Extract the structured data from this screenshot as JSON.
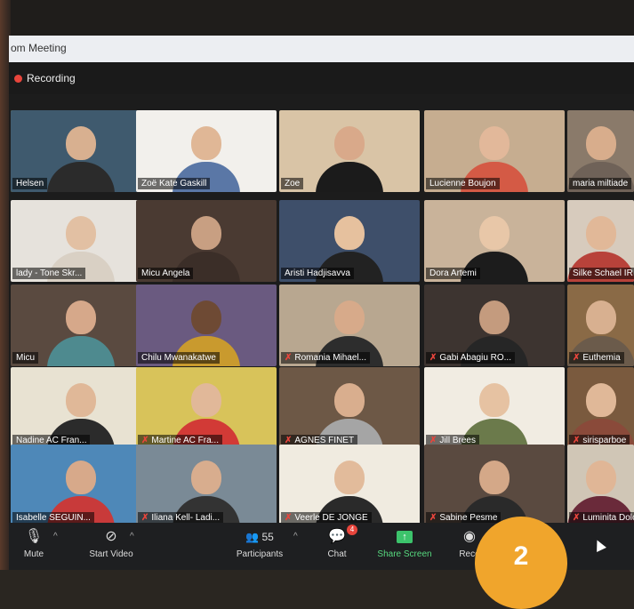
{
  "window": {
    "title": "om Meeting"
  },
  "recording": {
    "label": "Recording"
  },
  "participants": [
    {
      "name": "Helsen",
      "muted": false,
      "bg": "#3f5a6e",
      "skin": "#d8b090",
      "shirt": "#2b2b2b"
    },
    {
      "name": "Zoë Kate Gaskill",
      "muted": false,
      "bg": "#f2f0ec",
      "skin": "#e0b796",
      "shirt": "#5a77a6"
    },
    {
      "name": "Zoe",
      "muted": false,
      "bg": "#d9c4a6",
      "skin": "#d9a98a",
      "shirt": "#1b1b1b"
    },
    {
      "name": "Lucienne Boujon",
      "muted": false,
      "bg": "#c6ad90",
      "skin": "#e2b89a",
      "shirt": "#d45a45"
    },
    {
      "name": "maria miltiade",
      "muted": false,
      "bg": "#8a7a6a",
      "skin": "#d8ad8c",
      "shirt": "#6f6258"
    },
    {
      "name": "lady - Tone Skr...",
      "muted": false,
      "bg": "#e6e2dc",
      "skin": "#e2c0a3",
      "shirt": "#d9d0c4"
    },
    {
      "name": "Micu Angela",
      "muted": false,
      "bg": "#4a3a32",
      "skin": "#c89f82",
      "shirt": "#3b2e28"
    },
    {
      "name": "Aristi Hadjisavva",
      "muted": false,
      "bg": "#3e4f6a",
      "skin": "#e6c19e",
      "shirt": "#222"
    },
    {
      "name": "Dora Artemi",
      "muted": false,
      "bg": "#c9b39a",
      "skin": "#e8c7a8",
      "shirt": "#1c1c1c"
    },
    {
      "name": "Silke Schael IR",
      "muted": false,
      "bg": "#d7cbbd",
      "skin": "#e1b898",
      "shirt": "#b8423a"
    },
    {
      "name": "Micu",
      "muted": false,
      "bg": "#5a4a40",
      "skin": "#d6a88a",
      "shirt": "#4e8a8f"
    },
    {
      "name": "Chilu Mwanakatwe",
      "muted": false,
      "bg": "#6a5a80",
      "skin": "#6e4a34",
      "shirt": "#c99a2e"
    },
    {
      "name": "Romania Mihael...",
      "muted": true,
      "bg": "#b8a790",
      "skin": "#d7aa8a",
      "shirt": "#2d2d2d"
    },
    {
      "name": "Gabi Abagiu RO...",
      "muted": true,
      "bg": "#3d3430",
      "skin": "#c49b7e",
      "shirt": "#262626"
    },
    {
      "name": "Euthemia",
      "muted": true,
      "bg": "#8a6a46",
      "skin": "#d8b090",
      "shirt": "#6b5b4b"
    },
    {
      "name": "Nadine AC Fran...",
      "muted": false,
      "bg": "#e8e2d2",
      "skin": "#e0b898",
      "shirt": "#2b2b2b"
    },
    {
      "name": "Martine AC Fra...",
      "muted": true,
      "bg": "#d8c35a",
      "skin": "#e1b899",
      "shirt": "#d23a36"
    },
    {
      "name": "AGNES FINET",
      "muted": true,
      "bg": "#6d5846",
      "skin": "#d9ae8e",
      "shirt": "#a5a5a5"
    },
    {
      "name": "Jill Brees",
      "muted": true,
      "bg": "#f1ece2",
      "skin": "#e6c2a2",
      "shirt": "#6b7a4b"
    },
    {
      "name": "sirisparboe",
      "muted": true,
      "bg": "#7a5a3e",
      "skin": "#e0b898",
      "shirt": "#8a4a3a"
    },
    {
      "name": "Isabelle SEGUIN...",
      "muted": false,
      "bg": "#4e88b8",
      "skin": "#d7a98a",
      "shirt": "#c83a3a"
    },
    {
      "name": "Iliana Kell- Ladi...",
      "muted": true,
      "bg": "#7a8a96",
      "skin": "#d8ad8e",
      "shirt": "#333"
    },
    {
      "name": "Veerle DE JONGE",
      "muted": true,
      "bg": "#f0ebe0",
      "skin": "#e2bb9b",
      "shirt": "#2a2a2a"
    },
    {
      "name": "Sabine Pesme",
      "muted": true,
      "bg": "#5a4a40",
      "skin": "#d4a888",
      "shirt": "#2a2a2a"
    },
    {
      "name": "Luminita Dolo",
      "muted": true,
      "bg": "#d0c6b6",
      "skin": "#e0b696",
      "shirt": "#6a2a3a"
    }
  ],
  "toolbar": {
    "mute": "Mute",
    "start_video": "Start Video",
    "participants_count": "55",
    "participants": "Participants",
    "chat": "Chat",
    "chat_badge": "4",
    "share_screen": "Share Screen",
    "record": "Reco"
  },
  "overlay_number": "2"
}
